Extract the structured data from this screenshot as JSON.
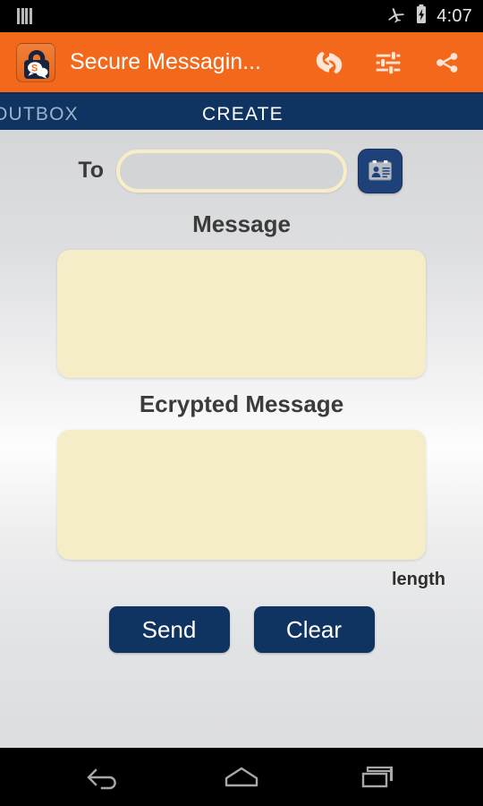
{
  "status_bar": {
    "signal_icon": "signal-bars-icon",
    "airplane_icon": "airplane-mode-icon",
    "battery_icon": "battery-charging-icon",
    "time": "4:07"
  },
  "action_bar": {
    "app_icon": "secure-lock-chat-icon",
    "title": "Secure Messagin...",
    "actions": [
      {
        "name": "refresh-icon",
        "label": "Refresh"
      },
      {
        "name": "settings-sliders-icon",
        "label": "Settings"
      },
      {
        "name": "share-icon",
        "label": "Share"
      }
    ],
    "background_color": "#f4681c"
  },
  "tabs": {
    "outbox_label": "OUTBOX",
    "create_label": "CREATE",
    "active": "CREATE",
    "background_color": "#103461",
    "active_color": "#ffffff",
    "inactive_color": "#9fb3cc"
  },
  "form": {
    "to_label": "To",
    "to_value": "",
    "to_placeholder": "",
    "contacts_button_icon": "contact-card-icon",
    "message_label": "Message",
    "message_value": "",
    "message_placeholder": "",
    "encrypted_label": "Ecrypted Message",
    "encrypted_value": "",
    "encrypted_placeholder": "",
    "length_label": "length",
    "send_label": "Send",
    "clear_label": "Clear",
    "field_fill_color": "#f5ecc8",
    "button_color": "#103461"
  },
  "nav_bar": {
    "back_icon": "back-arrow-icon",
    "home_icon": "home-icon",
    "recents_icon": "recent-apps-icon"
  }
}
